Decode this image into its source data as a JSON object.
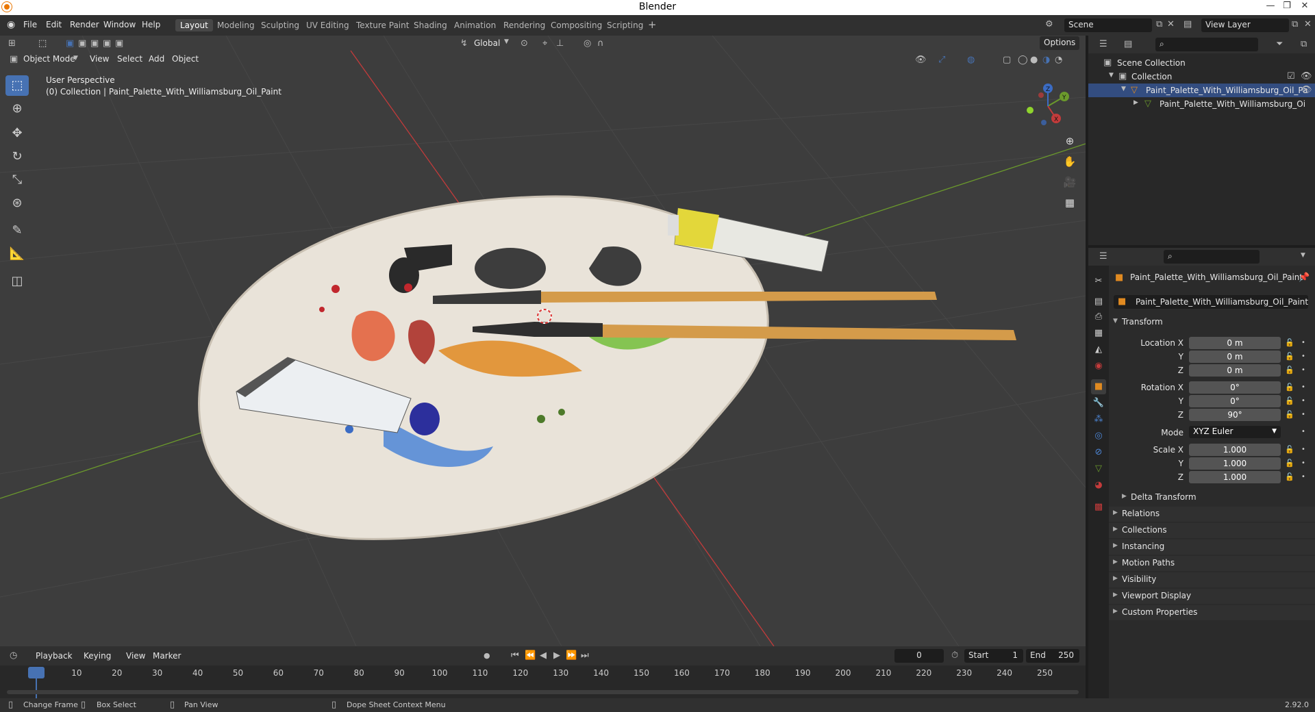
{
  "window": {
    "title": "Blender",
    "minimize": "—",
    "restore": "❐",
    "close": "✕"
  },
  "menus": [
    "File",
    "Edit",
    "Render",
    "Window",
    "Help"
  ],
  "workspaces": [
    "Layout",
    "Modeling",
    "Sculpting",
    "UV Editing",
    "Texture Paint",
    "Shading",
    "Animation",
    "Rendering",
    "Compositing",
    "Scripting"
  ],
  "active_workspace": "Layout",
  "scene": {
    "name": "Scene",
    "view_layer": "View Layer"
  },
  "viewport_header": {
    "mode": "Object Mode",
    "menu_view": "View",
    "menu_select": "Select",
    "menu_add": "Add",
    "menu_object": "Object",
    "orientation": "Global",
    "options": "Options"
  },
  "viewport_info": {
    "perspective": "User Perspective",
    "collection": "(0) Collection | Paint_Palette_With_Williamsburg_Oil_Paint"
  },
  "gizmo": {
    "x": "X",
    "y": "Y",
    "z": "Z"
  },
  "outliner": {
    "scene_collection": "Scene Collection",
    "collection": "Collection",
    "object": "Paint_Palette_With_Williamsburg_Oil_Pa",
    "mesh": "Paint_Palette_With_Williamsburg_Oi"
  },
  "properties": {
    "object_name": "Paint_Palette_With_Williamsburg_Oil_Paint",
    "object_field": "Paint_Palette_With_Williamsburg_Oil_Paint",
    "transform_title": "Transform",
    "location_label": "Location X",
    "rotation_label": "Rotation X",
    "scale_label": "Scale X",
    "y_label": "Y",
    "z_label": "Z",
    "mode_label": "Mode",
    "location": {
      "x": "0 m",
      "y": "0 m",
      "z": "0 m"
    },
    "rotation": {
      "x": "0°",
      "y": "0°",
      "z": "90°"
    },
    "mode": "XYZ Euler",
    "scale": {
      "x": "1.000",
      "y": "1.000",
      "z": "1.000"
    },
    "delta_transform": "Delta Transform",
    "panels": [
      "Relations",
      "Collections",
      "Instancing",
      "Motion Paths",
      "Visibility",
      "Viewport Display",
      "Custom Properties"
    ]
  },
  "timeline": {
    "playback": "Playback",
    "keying": "Keying",
    "view": "View",
    "marker": "Marker",
    "current_frame": "0",
    "start_label": "Start",
    "start": "1",
    "end_label": "End",
    "end": "250",
    "ruler": [
      "0",
      "10",
      "20",
      "30",
      "40",
      "50",
      "60",
      "70",
      "80",
      "90",
      "100",
      "110",
      "120",
      "130",
      "140",
      "150",
      "160",
      "170",
      "180",
      "190",
      "200",
      "210",
      "220",
      "230",
      "240",
      "250"
    ]
  },
  "statusbar": {
    "change_frame": "Change Frame",
    "box_select": "Box Select",
    "pan_view": "Pan View",
    "context_menu": "Dope Sheet Context Menu",
    "version": "2.92.0"
  },
  "colors": {
    "accent": "#4772b3",
    "x_axis": "#c43b3b",
    "y_axis": "#6b9a2c",
    "header": "#303030",
    "viewport": "#3d3d3d"
  }
}
